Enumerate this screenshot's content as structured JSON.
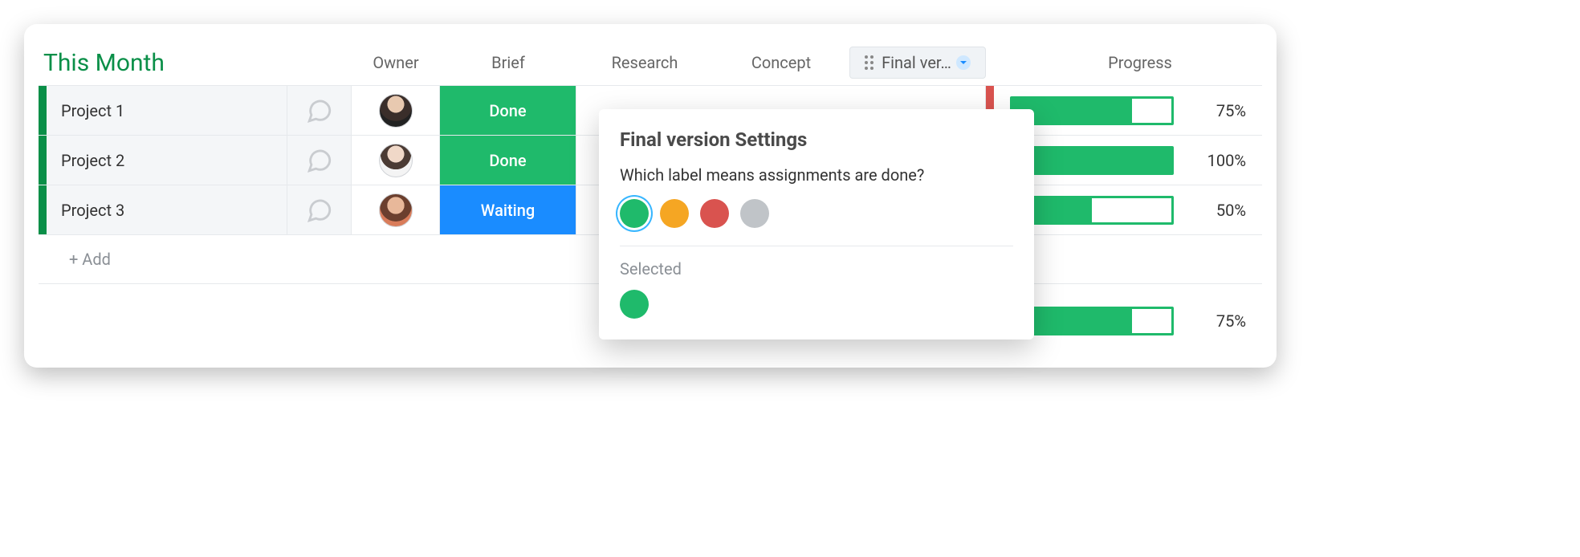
{
  "header": {
    "title": "This Month",
    "columns": {
      "owner": "Owner",
      "brief": "Brief",
      "research": "Research",
      "concept": "Concept",
      "final": "Final ver…",
      "progress": "Progress"
    }
  },
  "rows": [
    {
      "name": "Project 1",
      "brief": {
        "label": "Done",
        "bg": "#1fba6b"
      },
      "side_stripe": "#d9534f",
      "progress": {
        "value": 75,
        "display": "75%"
      }
    },
    {
      "name": "Project 2",
      "brief": {
        "label": "Done",
        "bg": "#1fba6b"
      },
      "side_stripe": "#1fba6b",
      "progress": {
        "value": 100,
        "display": "100%"
      }
    },
    {
      "name": "Project 3",
      "brief": {
        "label": "Waiting",
        "bg": "#1a8cff"
      },
      "side_stripe": "#9fe0bd",
      "progress": {
        "value": 50,
        "display": "50%"
      }
    }
  ],
  "add_row": {
    "label": "+ Add"
  },
  "summary_progress": {
    "value": 75,
    "display": "75%"
  },
  "popover": {
    "title": "Final version Settings",
    "question": "Which label means assignments are done?",
    "swatches": [
      "#1fba6b",
      "#f5a623",
      "#d9534f",
      "#c0c4c8"
    ],
    "selected_index": 0,
    "selected_label": "Selected",
    "selected_color": "#1fba6b"
  },
  "colors": {
    "group_title": "#0a8f48",
    "done": "#1fba6b",
    "waiting": "#1a8cff"
  }
}
